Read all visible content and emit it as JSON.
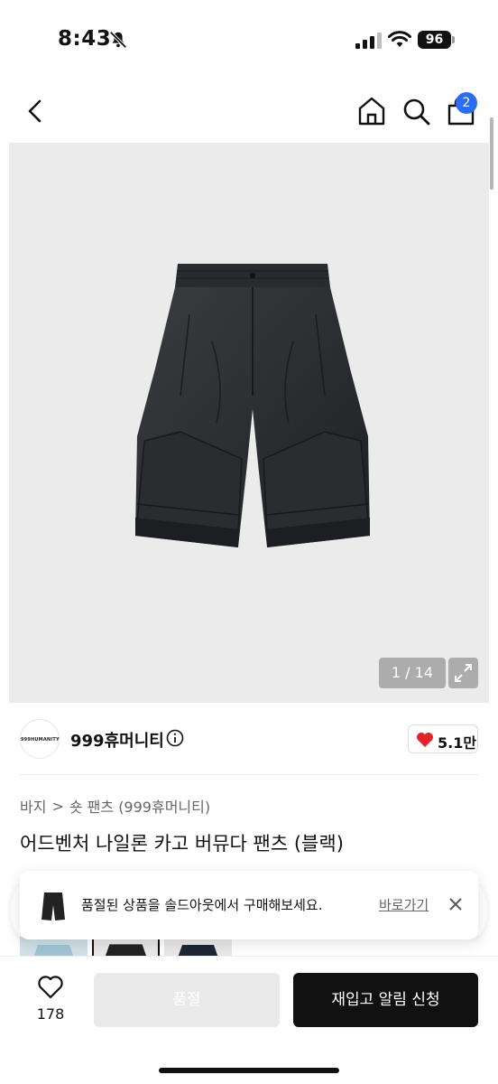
{
  "status_bar": {
    "time": "8:43",
    "battery": "96"
  },
  "nav": {
    "cart_count": "2"
  },
  "gallery": {
    "counter": "1 / 14"
  },
  "store": {
    "name": "999휴머니티",
    "logo_text": "999HUMANITY",
    "likes": "5.1만"
  },
  "breadcrumb": {
    "category": "바지",
    "separator": ">",
    "subcategory": "숏 팬츠 (999휴머니티)"
  },
  "product": {
    "title": "어드벤처 나일론 카고 버뮤다 팬츠 (블랙)"
  },
  "toast": {
    "message": "품절된 상품을 솔드아웃에서 구매해보세요.",
    "link_label": "바로가기"
  },
  "bottom_bar": {
    "wish_count": "178",
    "soldout_label": "품절",
    "restock_label": "재입고 알림 신청"
  },
  "colors": {
    "badge_blue": "#2a6df4",
    "heart_red": "#e5232b",
    "primary_black": "#111111",
    "disabled_gray": "#e9e9e9"
  }
}
